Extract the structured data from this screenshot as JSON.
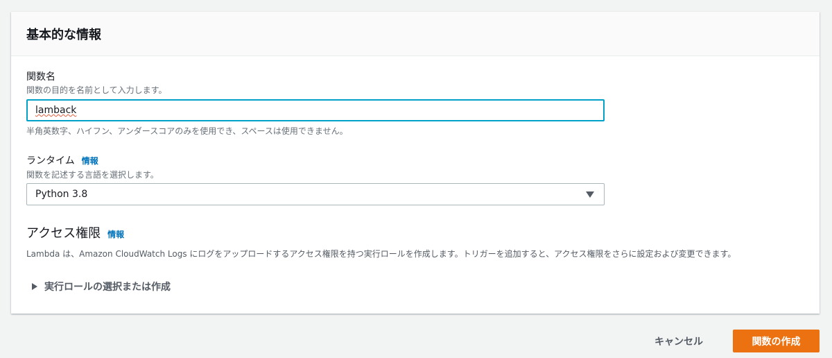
{
  "section_title": "基本的な情報",
  "function_name": {
    "label": "関数名",
    "description": "関数の目的を名前として入力します。",
    "value": "lamback",
    "hint": "半角英数字、ハイフン、アンダースコアのみを使用でき、スペースは使用できません。"
  },
  "runtime": {
    "label": "ランタイム",
    "info": "情報",
    "description": "関数を記述する言語を選択します。",
    "value": "Python 3.8"
  },
  "permissions": {
    "title": "アクセス権限",
    "info": "情報",
    "description": "Lambda は、Amazon CloudWatch Logs にログをアップロードするアクセス権限を持つ実行ロールを作成します。トリガーを追加すると、アクセス権限をさらに設定および変更できます。",
    "expander": "実行ロールの選択または作成"
  },
  "buttons": {
    "cancel": "キャンセル",
    "create": "関数の作成"
  },
  "colors": {
    "primary": "#ec7211",
    "link": "#0073bb",
    "focus": "#00a1c9"
  }
}
